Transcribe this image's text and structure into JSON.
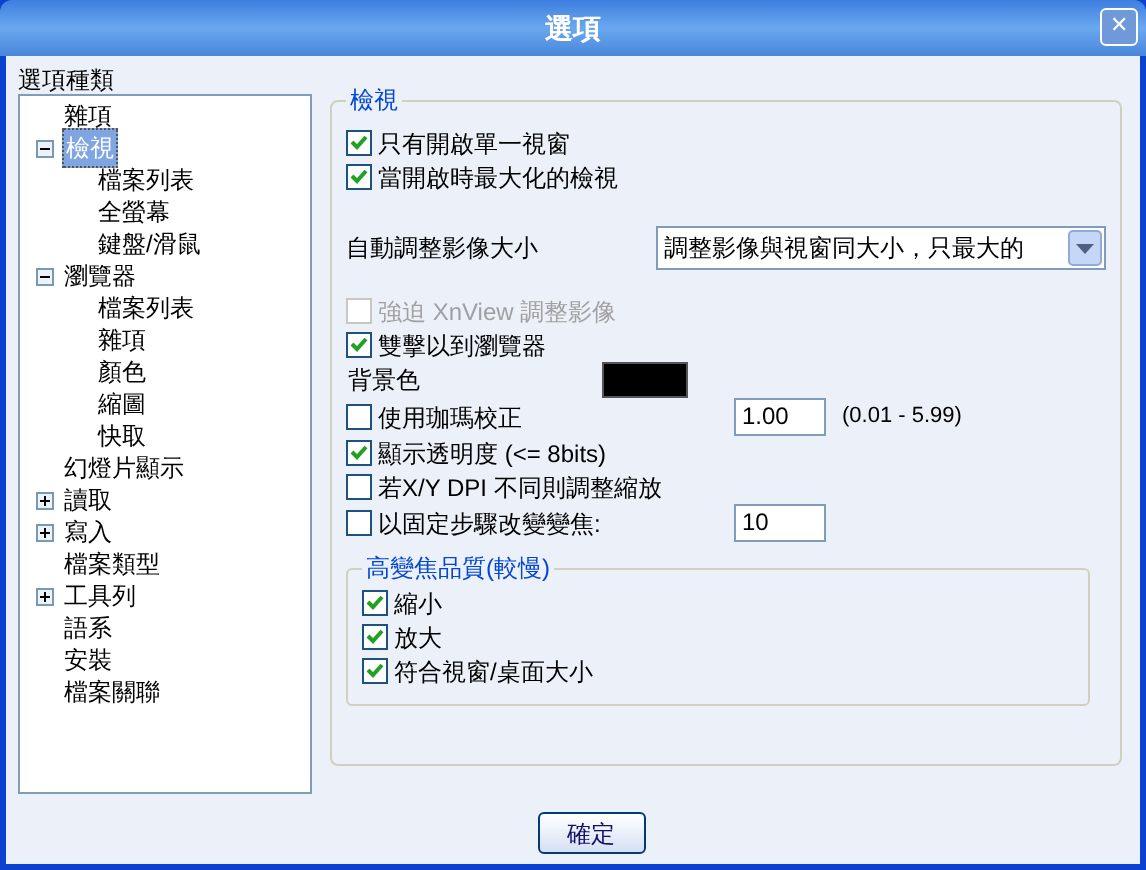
{
  "window": {
    "title": "選項",
    "close": "✕"
  },
  "category_label": "選項種類",
  "tree": [
    {
      "label": "雜項",
      "kind": "leaf",
      "selected": false
    },
    {
      "label": "檢視",
      "kind": "branch",
      "expanded": true,
      "selected": true,
      "children": [
        {
          "label": "檔案列表",
          "selected": false
        },
        {
          "label": "全螢幕",
          "selected": false
        },
        {
          "label": "鍵盤/滑鼠",
          "selected": false
        }
      ]
    },
    {
      "label": "瀏覽器",
      "kind": "branch",
      "expanded": true,
      "selected": false,
      "children": [
        {
          "label": "檔案列表",
          "selected": false
        },
        {
          "label": "雜項",
          "selected": false
        },
        {
          "label": "顏色",
          "selected": false
        },
        {
          "label": "縮圖",
          "selected": false
        },
        {
          "label": "快取",
          "selected": false
        }
      ]
    },
    {
      "label": "幻燈片顯示",
      "kind": "leaf",
      "selected": false
    },
    {
      "label": "讀取",
      "kind": "branch",
      "expanded": false,
      "selected": false
    },
    {
      "label": "寫入",
      "kind": "branch",
      "expanded": false,
      "selected": false
    },
    {
      "label": "檔案類型",
      "kind": "leaf",
      "selected": false
    },
    {
      "label": "工具列",
      "kind": "branch",
      "expanded": false,
      "selected": false
    },
    {
      "label": "語系",
      "kind": "leaf",
      "selected": false
    },
    {
      "label": "安裝",
      "kind": "leaf",
      "selected": false
    },
    {
      "label": "檔案關聯",
      "kind": "leaf",
      "selected": false
    }
  ],
  "group": {
    "title": "檢視",
    "items": [
      {
        "kind": "checkbox",
        "label": "只有開啟單一視窗",
        "checked": true,
        "disabled": false
      },
      {
        "kind": "checkbox",
        "label": "當開啟時最大化的檢視",
        "checked": true,
        "disabled": false
      },
      {
        "kind": "select",
        "label": "自動調整影像大小",
        "value": "調整影像與視窗同大小，只最大的"
      },
      {
        "kind": "checkbox",
        "label": "強迫 XnView 調整影像",
        "checked": false,
        "disabled": true
      },
      {
        "kind": "checkbox",
        "label": "雙擊以到瀏覽器",
        "checked": true,
        "disabled": false
      },
      {
        "kind": "color",
        "label": "背景色",
        "color": "#000000"
      },
      {
        "kind": "checkbox",
        "label": "使用珈瑪校正",
        "checked": false,
        "disabled": false,
        "value": "1.00",
        "hint": "(0.01 - 5.99)"
      },
      {
        "kind": "checkbox",
        "label": "顯示透明度 (<= 8bits)",
        "checked": true,
        "disabled": false
      },
      {
        "kind": "checkbox",
        "label": "若X/Y DPI 不同則調整縮放",
        "checked": false,
        "disabled": false
      },
      {
        "kind": "checkbox",
        "label": "以固定步驟改變變焦:",
        "checked": false,
        "disabled": false,
        "value": "10"
      },
      {
        "kind": "group",
        "title": "高變焦品質(較慢)",
        "items": [
          {
            "kind": "checkbox",
            "label": "縮小",
            "checked": true,
            "disabled": false
          },
          {
            "kind": "checkbox",
            "label": "放大",
            "checked": true,
            "disabled": false
          },
          {
            "kind": "checkbox",
            "label": "符合視窗/桌面大小",
            "checked": true,
            "disabled": false
          }
        ]
      }
    ]
  },
  "ok_button": "確定"
}
